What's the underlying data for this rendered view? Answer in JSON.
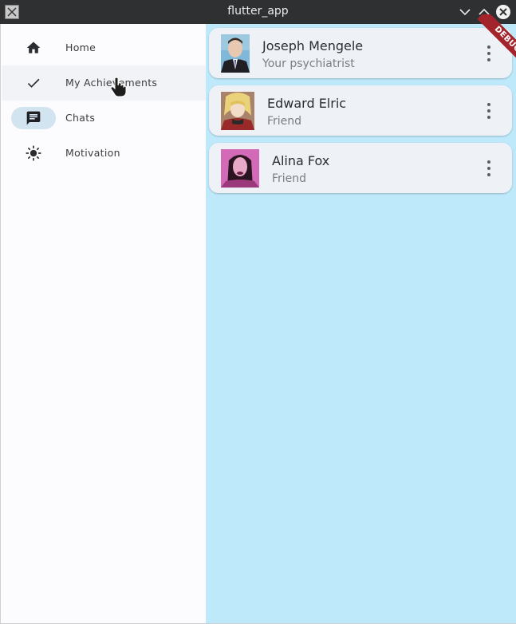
{
  "window": {
    "title": "flutter_app"
  },
  "rail": {
    "items": [
      {
        "label": "Home",
        "icon": "home-icon"
      },
      {
        "label": "My Achievements",
        "icon": "check-icon"
      },
      {
        "label": "Chats",
        "icon": "chat-icon",
        "selected": true
      },
      {
        "label": "Motivation",
        "icon": "sun-icon"
      }
    ]
  },
  "contacts": [
    {
      "name": "Joseph Mengele",
      "role": "Your psychiatrist"
    },
    {
      "name": "Edward Elric",
      "role": "Friend"
    },
    {
      "name": "Alina Fox",
      "role": "Friend"
    }
  ],
  "debug": {
    "label": "DEBUG"
  },
  "colors": {
    "content_bg": "#bee9fb",
    "rail_bg": "#fcfcff",
    "card_bg": "#eef2f6",
    "selected_indicator": "#d2e4f0",
    "debug_ribbon": "#a3252b"
  }
}
